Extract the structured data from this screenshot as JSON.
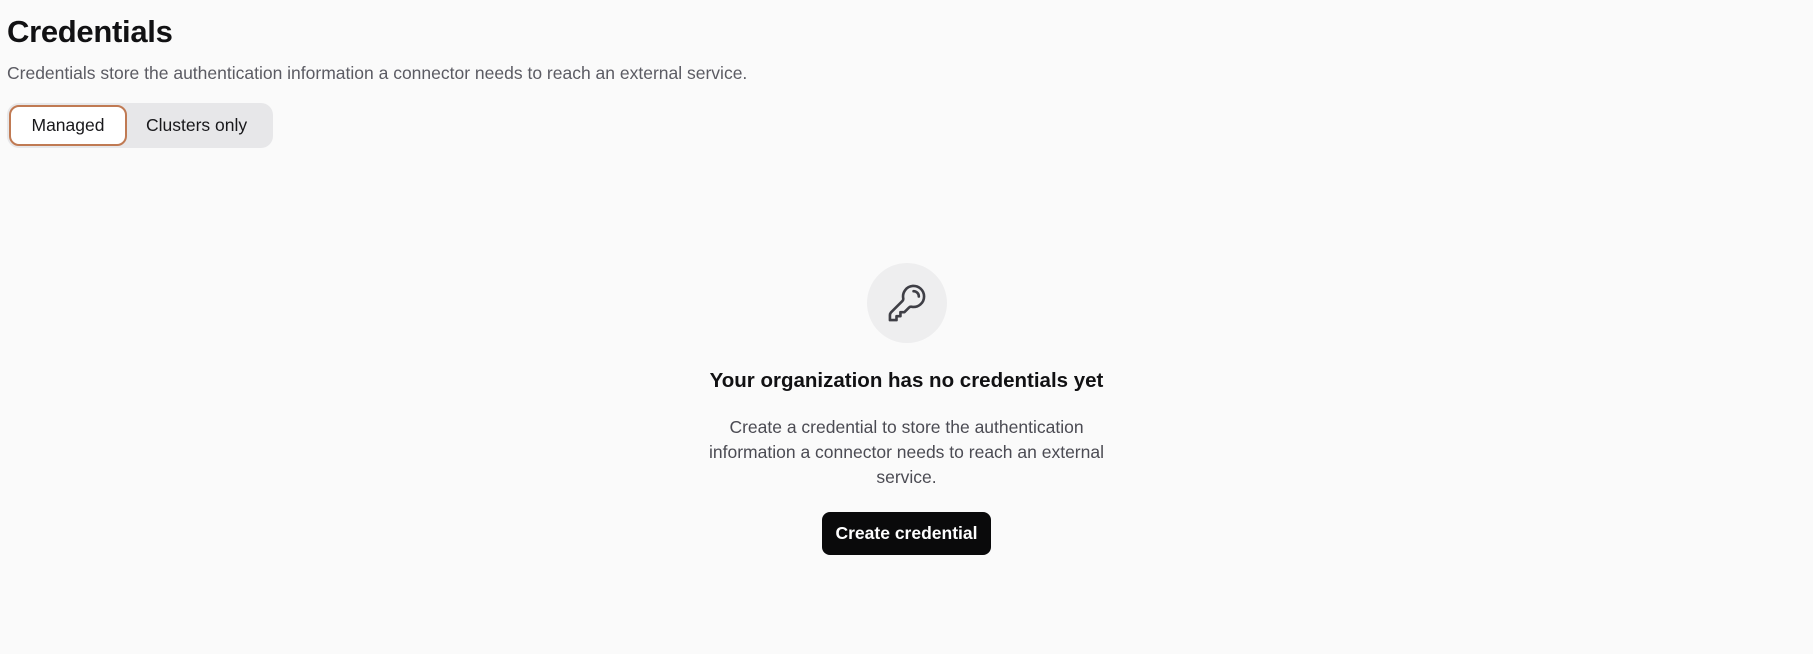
{
  "header": {
    "title": "Credentials",
    "subtitle": "Credentials store the authentication information a connector needs to reach an external service."
  },
  "filter": {
    "options": [
      {
        "label": "Managed",
        "selected": true
      },
      {
        "label": "Clusters only",
        "selected": false
      }
    ]
  },
  "empty_state": {
    "icon": "key-icon",
    "title": "Your organization has no credentials yet",
    "description": "Create a credential to store the authentication information a connector needs to reach an external service.",
    "button_label": "Create credential"
  },
  "colors": {
    "background": "#fafafa",
    "accent_ring": "#c07a53",
    "primary_button": "#0a0a0b"
  }
}
